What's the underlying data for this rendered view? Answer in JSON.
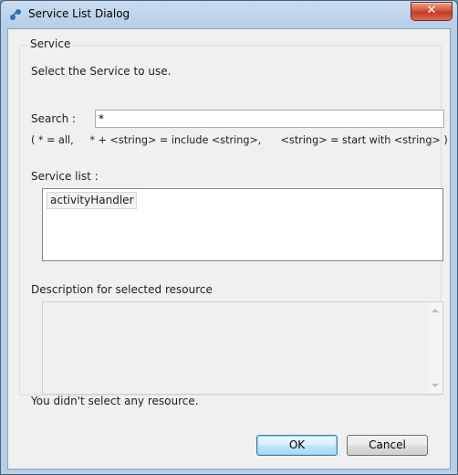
{
  "window": {
    "title": "Service List Dialog",
    "close_symbol": "✕"
  },
  "service_group": {
    "legend": "Service",
    "instruction": "Select the Service to use."
  },
  "search": {
    "label": "Search :",
    "value": "*",
    "hint": "( * = all,     * + <string> = include <string>,      <string> = start with <string> )"
  },
  "service_list": {
    "label": "Service list :",
    "items": [
      "activityHandler"
    ]
  },
  "description": {
    "label": "Description for selected resource",
    "text": ""
  },
  "status_message": "You didn't select any resource.",
  "buttons": {
    "ok_label": "OK",
    "cancel_label": "Cancel"
  },
  "colors": {
    "accent": "#3c7fb1",
    "close_button": "#c23a21",
    "dialog_background": "#f0f0f0"
  }
}
